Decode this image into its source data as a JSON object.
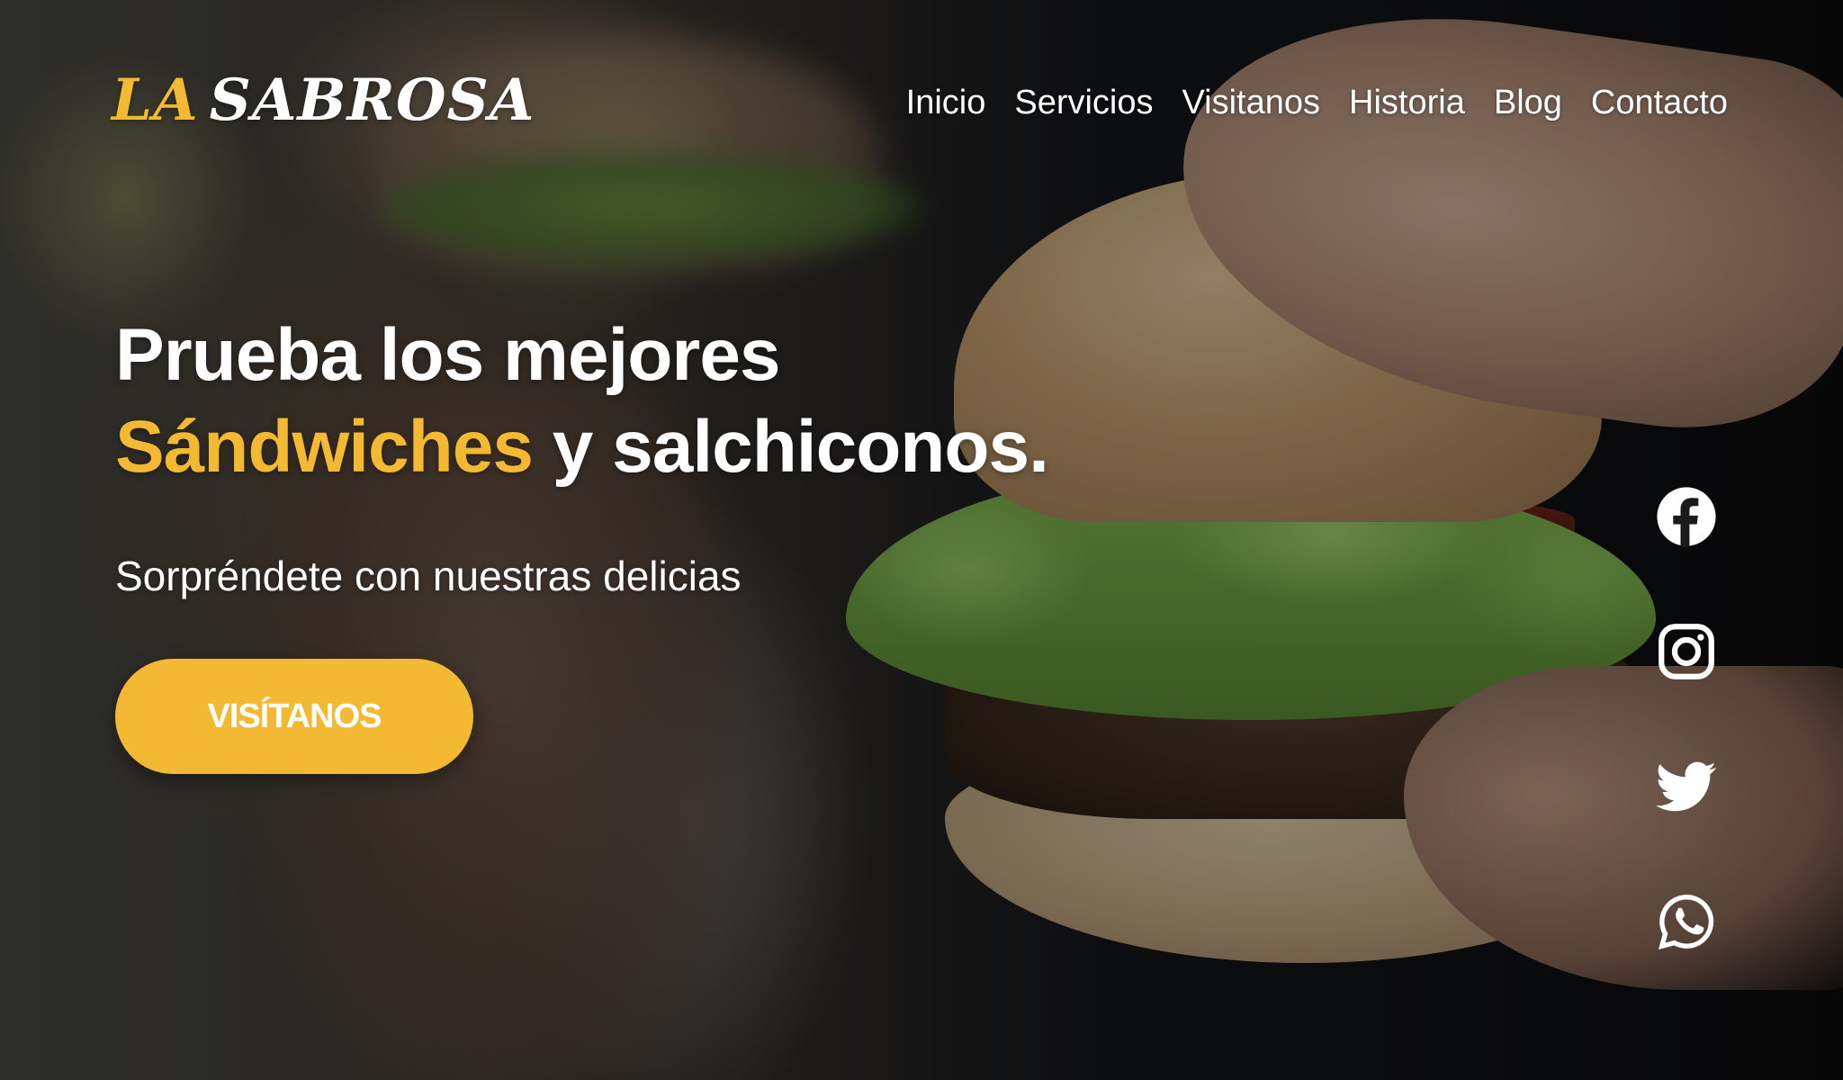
{
  "brand": {
    "logo_accent": "LA",
    "logo_main": "SABROSA",
    "accent_color": "#f4b933"
  },
  "nav": {
    "items": [
      {
        "label": "Inicio"
      },
      {
        "label": "Servicios"
      },
      {
        "label": "Visitanos"
      },
      {
        "label": "Historia"
      },
      {
        "label": "Blog"
      },
      {
        "label": "Contacto"
      }
    ]
  },
  "hero": {
    "title_line1": "Prueba los mejores",
    "title_accent": "Sándwiches",
    "title_rest": " y salchiconos.",
    "subtitle": "Sorpréndete con nuestras delicias",
    "cta_label": "VISÍTANOS"
  },
  "social": {
    "icons": [
      "facebook-icon",
      "instagram-icon",
      "twitter-icon",
      "whatsapp-icon"
    ]
  }
}
